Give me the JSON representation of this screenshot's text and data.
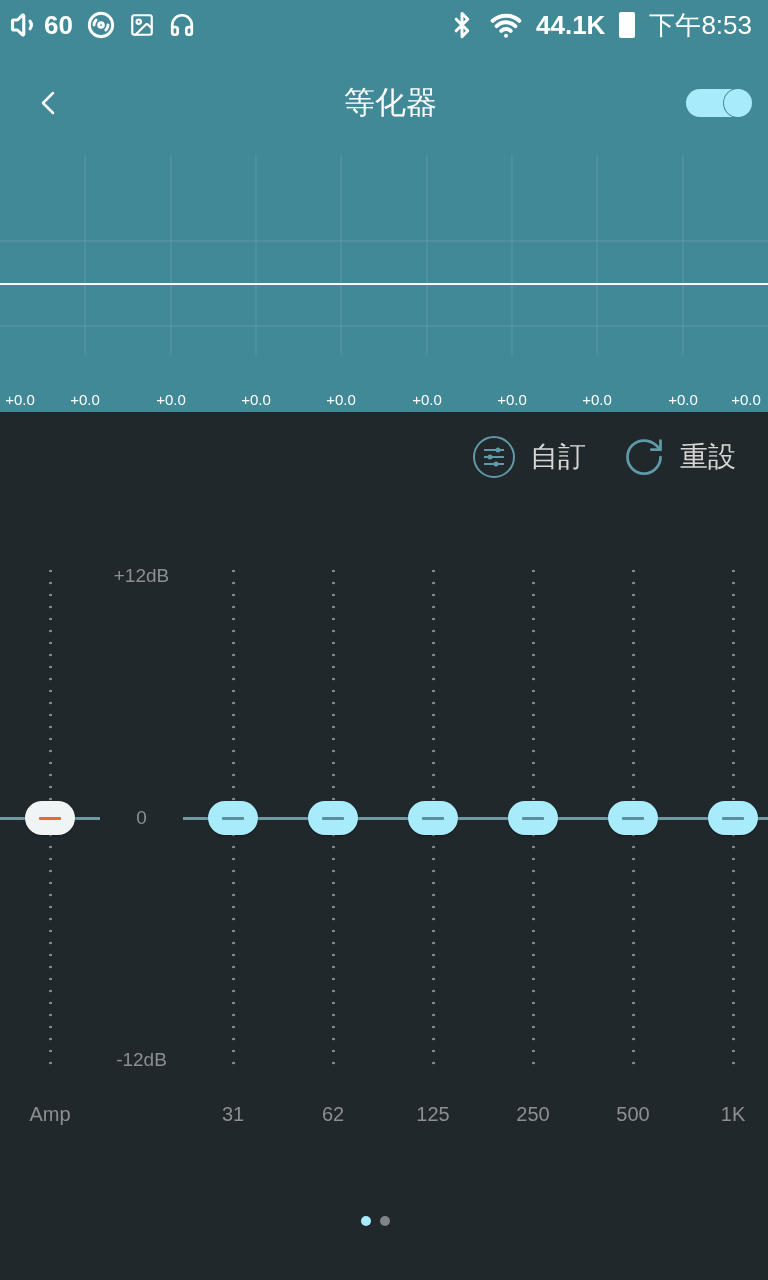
{
  "status_bar": {
    "volume": "60",
    "sample_rate": "44.1K",
    "time": "下午8:53"
  },
  "header": {
    "title": "等化器",
    "enabled": true
  },
  "curve_labels": [
    "+0.0",
    "+0.0",
    "+0.0",
    "+0.0",
    "+0.0",
    "+0.0",
    "+0.0",
    "+0.0",
    "+0.0",
    "+0.0"
  ],
  "actions": [
    {
      "kind": "custom",
      "label": "自訂"
    },
    {
      "kind": "reset",
      "label": "重設"
    }
  ],
  "scale": {
    "top": "+12dB",
    "zero": "0",
    "bottom": "-12dB"
  },
  "bands": [
    {
      "kind": "amp",
      "label": "Amp",
      "level": 0.5
    },
    {
      "kind": "band",
      "label": "31",
      "level": 0.5
    },
    {
      "kind": "band",
      "label": "62",
      "level": 0.5
    },
    {
      "kind": "band",
      "label": "125",
      "level": 0.5
    },
    {
      "kind": "band",
      "label": "250",
      "level": 0.5
    },
    {
      "kind": "band",
      "label": "500",
      "level": 0.5
    },
    {
      "kind": "band",
      "label": "1K",
      "level": 0.5
    }
  ],
  "pages": [
    {
      "selected": true
    },
    {
      "selected": false
    }
  ]
}
